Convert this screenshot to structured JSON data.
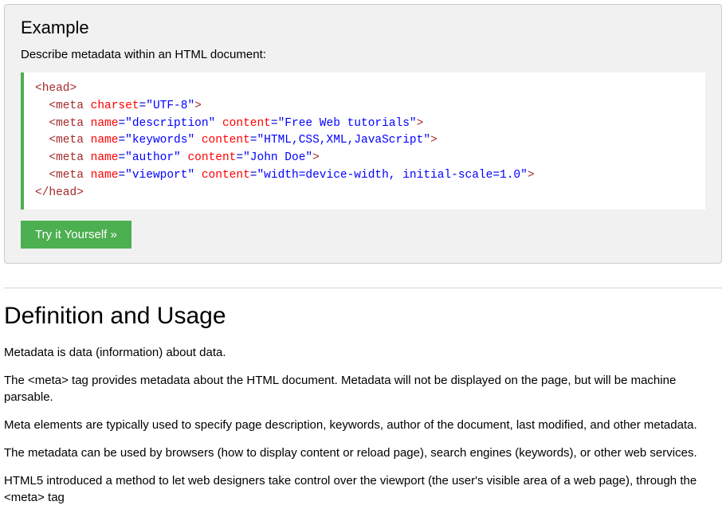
{
  "example": {
    "title": "Example",
    "description": "Describe metadata within an HTML document:",
    "code": {
      "l1": {
        "open": "<head>"
      },
      "l2": {
        "open": "  <meta",
        "a1": " charset",
        "e1": "=",
        "v1": "\"UTF-8\"",
        "close": ">"
      },
      "l3": {
        "open": "  <meta",
        "a1": " name",
        "e1": "=",
        "v1": "\"description\"",
        "a2": " content",
        "e2": "=",
        "v2": "\"Free Web tutorials\"",
        "close": ">"
      },
      "l4": {
        "open": "  <meta",
        "a1": " name",
        "e1": "=",
        "v1": "\"keywords\"",
        "a2": " content",
        "e2": "=",
        "v2": "\"HTML,CSS,XML,JavaScript\"",
        "close": ">"
      },
      "l5": {
        "open": "  <meta",
        "a1": " name",
        "e1": "=",
        "v1": "\"author\"",
        "a2": " content",
        "e2": "=",
        "v2": "\"John Doe\"",
        "close": ">"
      },
      "l6": {
        "open": "  <meta",
        "a1": " name",
        "e1": "=",
        "v1": "\"viewport\"",
        "a2": " content",
        "e2": "=",
        "v2": "\"width=device-width, initial-scale=1.0\"",
        "close": ">"
      },
      "l7": {
        "open": "</head>"
      }
    },
    "try_button": "Try it Yourself »"
  },
  "definition": {
    "title": "Definition and Usage",
    "p1": "Metadata is data (information) about data.",
    "p2": "The <meta> tag provides metadata about the HTML document. Metadata will not be displayed on the page, but will be machine parsable.",
    "p3": "Meta elements are typically used to specify page description, keywords, author of the document, last modified, and other metadata.",
    "p4": "The metadata can be used by browsers (how to display content or reload page), search engines (keywords), or other web services.",
    "p5": "HTML5 introduced a method to let web designers take control over the viewport (the user's visible area of a web page), through the <meta> tag"
  }
}
